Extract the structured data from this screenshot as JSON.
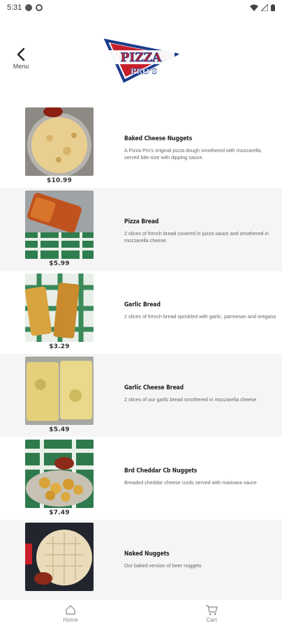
{
  "status_bar": {
    "time": "5:31"
  },
  "header": {
    "back_label": "Menu",
    "logo_text_top": "PIZZA",
    "logo_text_bottom": "PRO'S"
  },
  "items": [
    {
      "name": "Baked Cheese Nuggets",
      "description": "A Pizza Pro's original pizza dough smothered with mozzarella, served bite-size with dipping sauce.",
      "price": "$10.99"
    },
    {
      "name": "Pizza Bread",
      "description": "2 slices of french bread covered in pizza sauce and smothered in mozzarella cheese",
      "price": "$5.99"
    },
    {
      "name": "Garlic Bread",
      "description": "2 slices of french bread sprinkled with garlic, parmesan and oregano",
      "price": "$3.29"
    },
    {
      "name": "Garlic Cheese Bread",
      "description": "2 slices of our garlic bread smothered in mozzarella cheese",
      "price": "$5.49"
    },
    {
      "name": "Brd Cheddar Cb Nuggets",
      "description": "Breaded cheddar cheese curds served with marinara sauce",
      "price": "$7.49"
    },
    {
      "name": "Naked Nuggets",
      "description": "Our baked version of beer nuggets",
      "price": ""
    }
  ],
  "bottom_nav": {
    "home_label": "Home",
    "cart_label": "Cart"
  },
  "colors": {
    "logo_blue": "#1c3c8c",
    "logo_red": "#c8202a",
    "alt_row": "#f5f5f5"
  }
}
